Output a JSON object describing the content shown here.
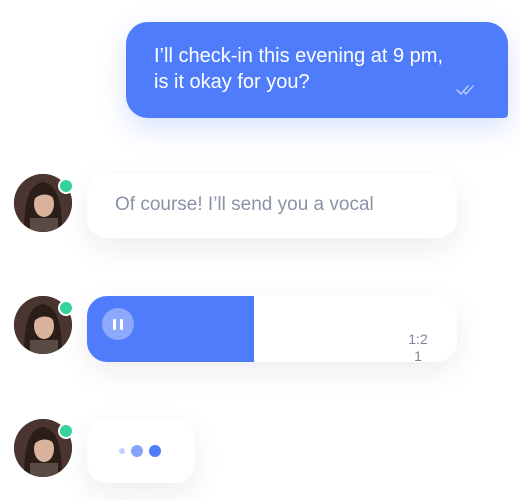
{
  "conversation": {
    "sent_message": {
      "text": "I’ll check-in this evening at 9 pm,\nis it okay for you?",
      "status_icon": "double-check-icon"
    },
    "received_text": {
      "text": "Of course! I’ll send you a vocal",
      "contact_online": true
    },
    "voice_message": {
      "duration": "1:21",
      "playback_progress": 0.45,
      "control_icon": "pause-icon"
    },
    "typing_indicator": {
      "dots": 3
    }
  },
  "colors": {
    "accent": "#4f7cfa",
    "online": "#34d399",
    "received_text": "#8a93a6",
    "background": "#ffffff"
  }
}
